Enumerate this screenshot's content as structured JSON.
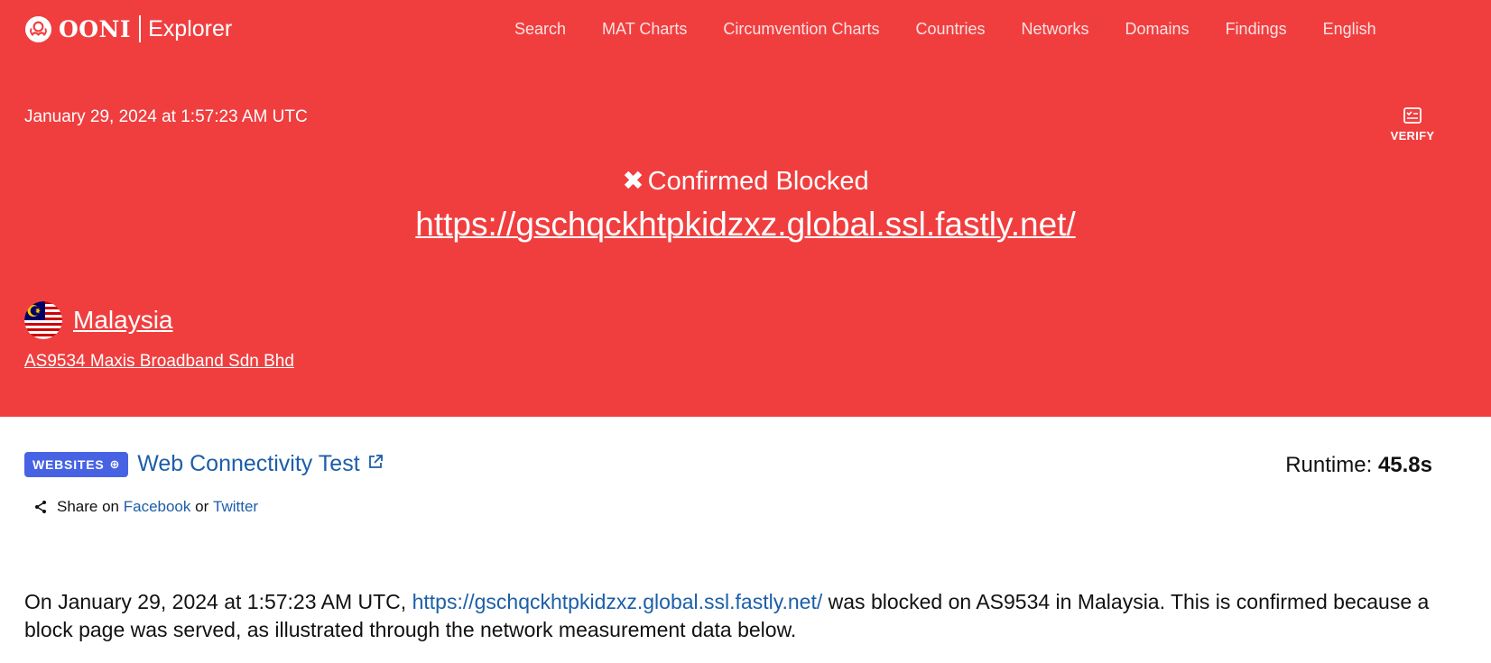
{
  "brand": {
    "name": "OONI",
    "product": "Explorer"
  },
  "nav": [
    "Search",
    "MAT Charts",
    "Circumvention Charts",
    "Countries",
    "Networks",
    "Domains",
    "Findings",
    "English"
  ],
  "header": {
    "datetime": "January 29, 2024 at 1:57:23 AM UTC",
    "verify": "VERIFY",
    "status_icon": "✖",
    "status": "Confirmed Blocked",
    "url": "https://gschqckhtpkidzxz.global.ssl.fastly.net/",
    "country": "Malaysia",
    "asn": "AS9534 Maxis Broadband Sdn Bhd"
  },
  "test": {
    "badge": "WEBSITES",
    "name": "Web Connectivity Test",
    "runtime_label": "Runtime:",
    "runtime_value": "45.8s"
  },
  "share": {
    "prefix": "Share on",
    "facebook": "Facebook",
    "or": "or",
    "twitter": "Twitter"
  },
  "summary": {
    "part1": "On January 29, 2024 at 1:57:23 AM UTC,",
    "url": "https://gschqckhtpkidzxz.global.ssl.fastly.net/",
    "part2": "was blocked on AS9534 in Malaysia. This is confirmed because a block page was served, as illustrated through the network measurement data below."
  },
  "colors": {
    "hero": "#f03e3f",
    "link": "#1c5ea8",
    "badge": "#4763e4"
  },
  "icons": [
    "ooni-logo-icon",
    "verify-checklist-icon",
    "x-icon",
    "malaysia-flag-icon",
    "globe-icon",
    "external-link-icon",
    "share-icon"
  ]
}
